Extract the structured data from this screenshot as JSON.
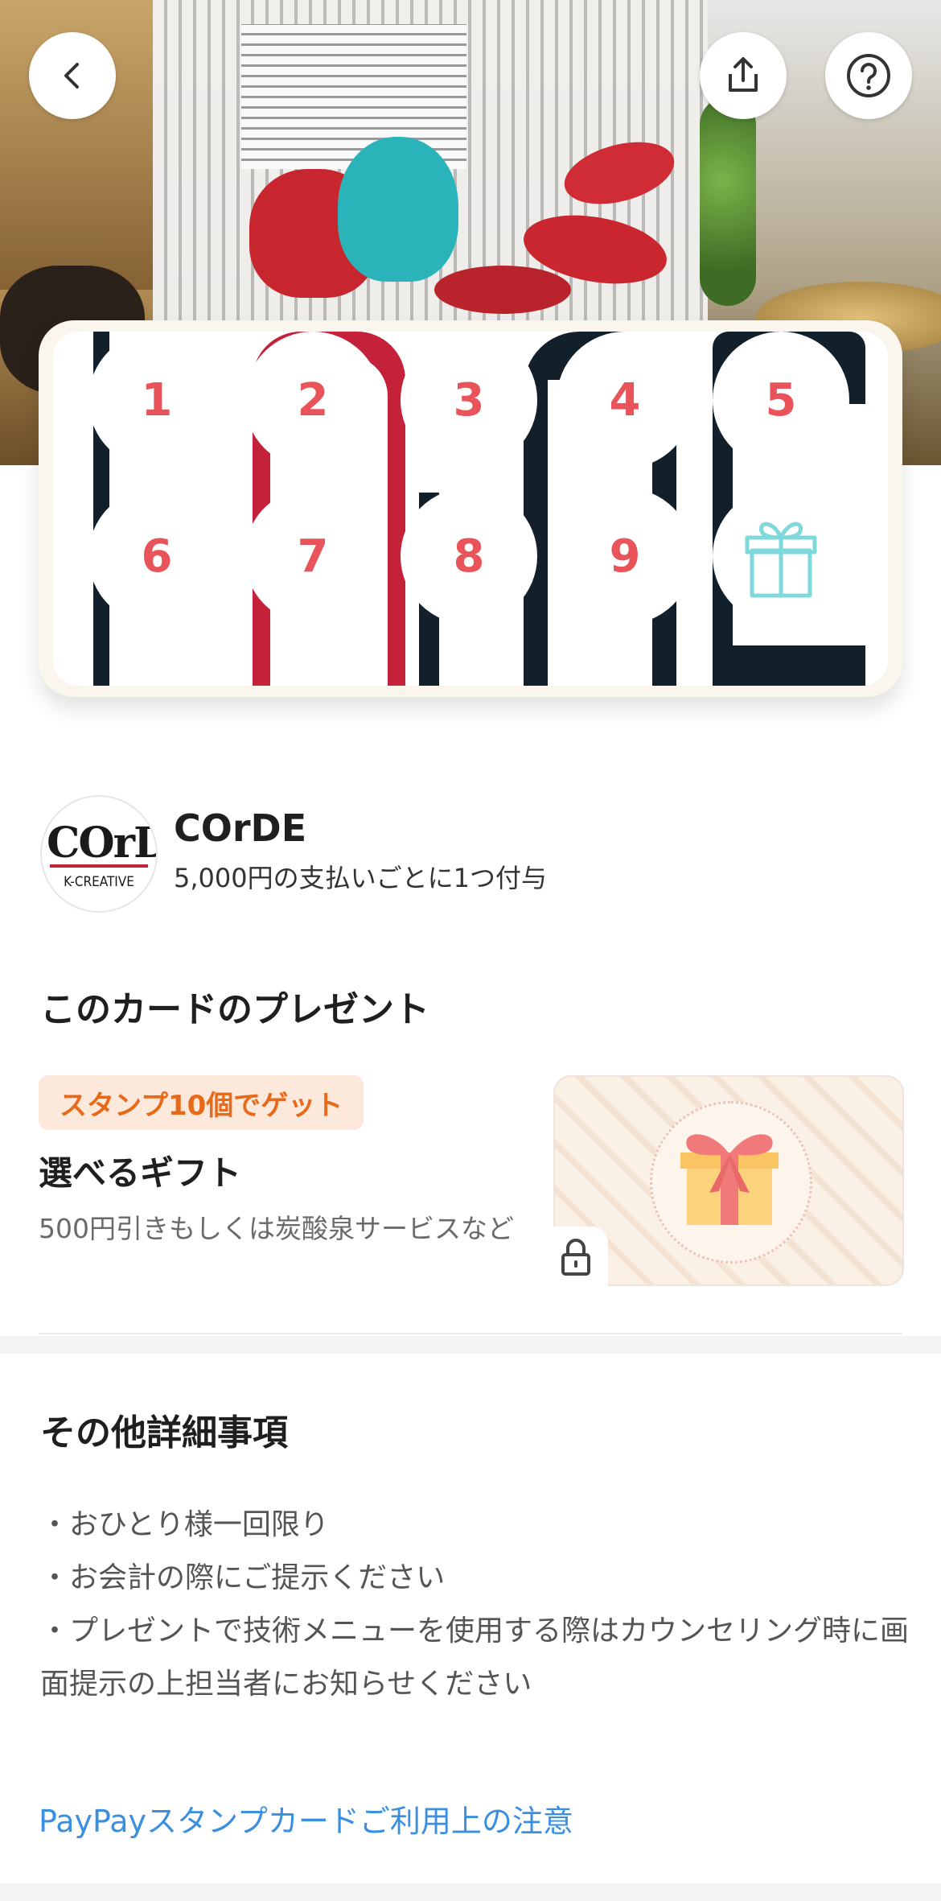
{
  "header": {
    "back_icon": "chevron-left-icon",
    "share_icon": "share-icon",
    "help_icon": "help-circle-icon"
  },
  "stamp_card": {
    "stamps": [
      "1",
      "2",
      "3",
      "4",
      "5",
      "6",
      "7",
      "8",
      "9"
    ],
    "reward_icon": "gift-icon",
    "reward_icon_color": "#7fd8dc",
    "stamp_number_color": "#e8545a"
  },
  "shop": {
    "logo_text": "COrDE",
    "logo_sub": "K-CREATIVE",
    "name": "COrDE",
    "rule": "5,000円の支払いごとに1つ付与"
  },
  "present": {
    "section_title": "このカードのプレゼント",
    "badge": "スタンプ10個でゲット",
    "title": "選べるギフト",
    "description": "500円引きもしくは炭酸泉サービスなど",
    "lock_icon": "lock-icon",
    "gift_icon": "gift-box-icon"
  },
  "details": {
    "section_title": "その他詳細事項",
    "items": [
      "・おひとり様一回限り",
      "・お会計の際にご提示ください",
      "・プレゼントで技術メニューを使用する際はカウンセリング時に画面提示の上担当者にお知らせください"
    ]
  },
  "footer": {
    "terms_link": "PayPayスタンプカードご利用上の注意",
    "link_color": "#3b8fe0"
  }
}
